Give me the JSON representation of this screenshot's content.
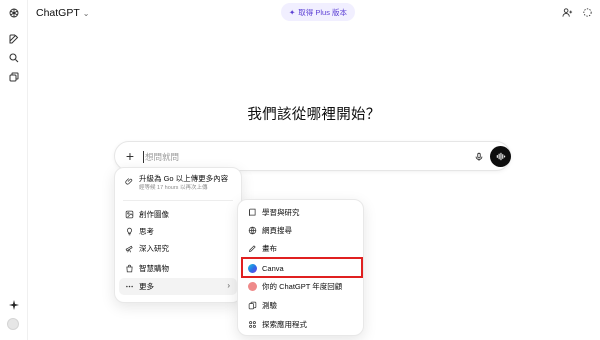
{
  "header": {
    "model_name": "ChatGPT",
    "upgrade_label": "取得 Plus 版本"
  },
  "main": {
    "heading": "我們該從哪裡開始？"
  },
  "composer": {
    "placeholder": "想問就問"
  },
  "attach_menu": {
    "upgrade": {
      "title": "升級為 Go 以上傳更多內容",
      "subtitle": "經等候 17 hours 以再次上傳"
    },
    "items": [
      {
        "label": "創作圖像",
        "icon": "image-create-icon"
      },
      {
        "label": "思考",
        "icon": "lightbulb-icon"
      },
      {
        "label": "深入研究",
        "icon": "telescope-icon"
      },
      {
        "label": "智慧購物",
        "icon": "shopping-bag-icon"
      },
      {
        "label": "更多",
        "icon": "more-dots-icon"
      }
    ]
  },
  "more_menu": {
    "items": [
      {
        "label": "學習與研究",
        "icon": "book-icon"
      },
      {
        "label": "網頁搜尋",
        "icon": "globe-icon"
      },
      {
        "label": "畫布",
        "icon": "canvas-pen-icon"
      },
      {
        "label": "Canva",
        "icon": "canva-logo-icon"
      },
      {
        "label": "你的 ChatGPT 年度回顧",
        "icon": "year-recap-icon"
      },
      {
        "label": "測驗",
        "icon": "quiz-cards-icon"
      },
      {
        "label": "探索應用程式",
        "icon": "apps-grid-icon"
      }
    ]
  },
  "colors": {
    "accent_purple": "#5b3fd4",
    "highlight_red": "#e02020",
    "send_black": "#0d0d0d"
  }
}
